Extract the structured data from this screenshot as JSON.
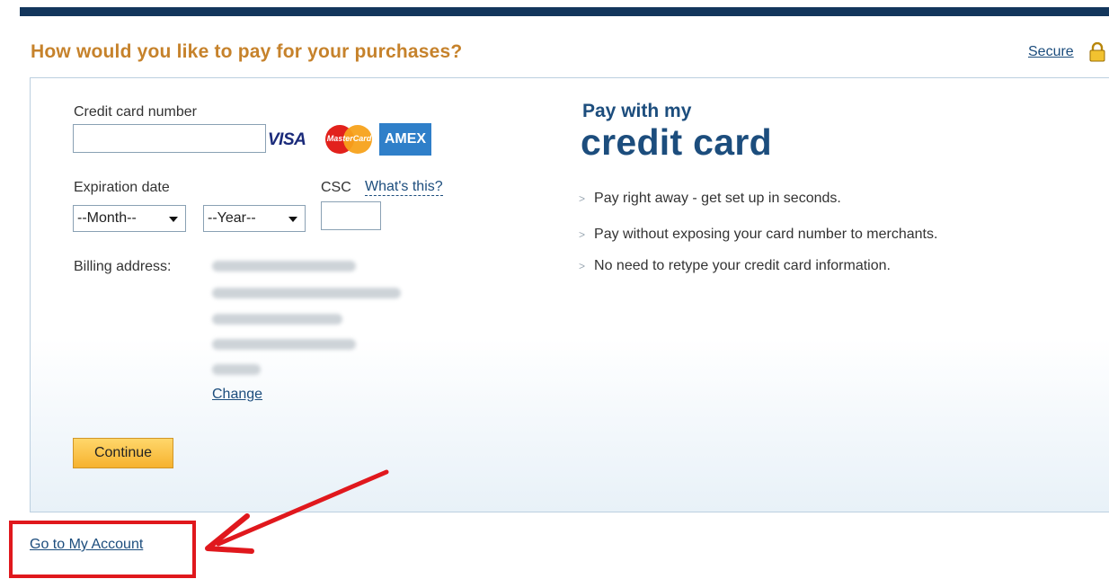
{
  "header": {
    "title": "How would you like to pay for your purchases?",
    "secure_label": "Secure"
  },
  "form": {
    "card_number_label": "Credit card number",
    "card_logos": {
      "visa": "VISA",
      "mastercard": "MasterCard",
      "amex": "AMEX"
    },
    "expiration_label": "Expiration date",
    "month_select": "--Month--",
    "year_select": "--Year--",
    "csc_label": "CSC",
    "whats_this_link": "What's this?",
    "billing_label": "Billing address:",
    "change_link": "Change",
    "continue_button": "Continue"
  },
  "info": {
    "heading_small": "Pay with my",
    "heading_big": "credit card",
    "bullets": [
      "Pay right away - get set up in seconds.",
      "Pay without exposing your card number to merchants.",
      "No need to retype your credit card information."
    ]
  },
  "footer": {
    "account_link": "Go to My Account"
  },
  "colors": {
    "title_orange": "#c6822b",
    "link_blue": "#1c4d7d",
    "annotation_red": "#e0181d",
    "top_bar": "#13365c"
  }
}
